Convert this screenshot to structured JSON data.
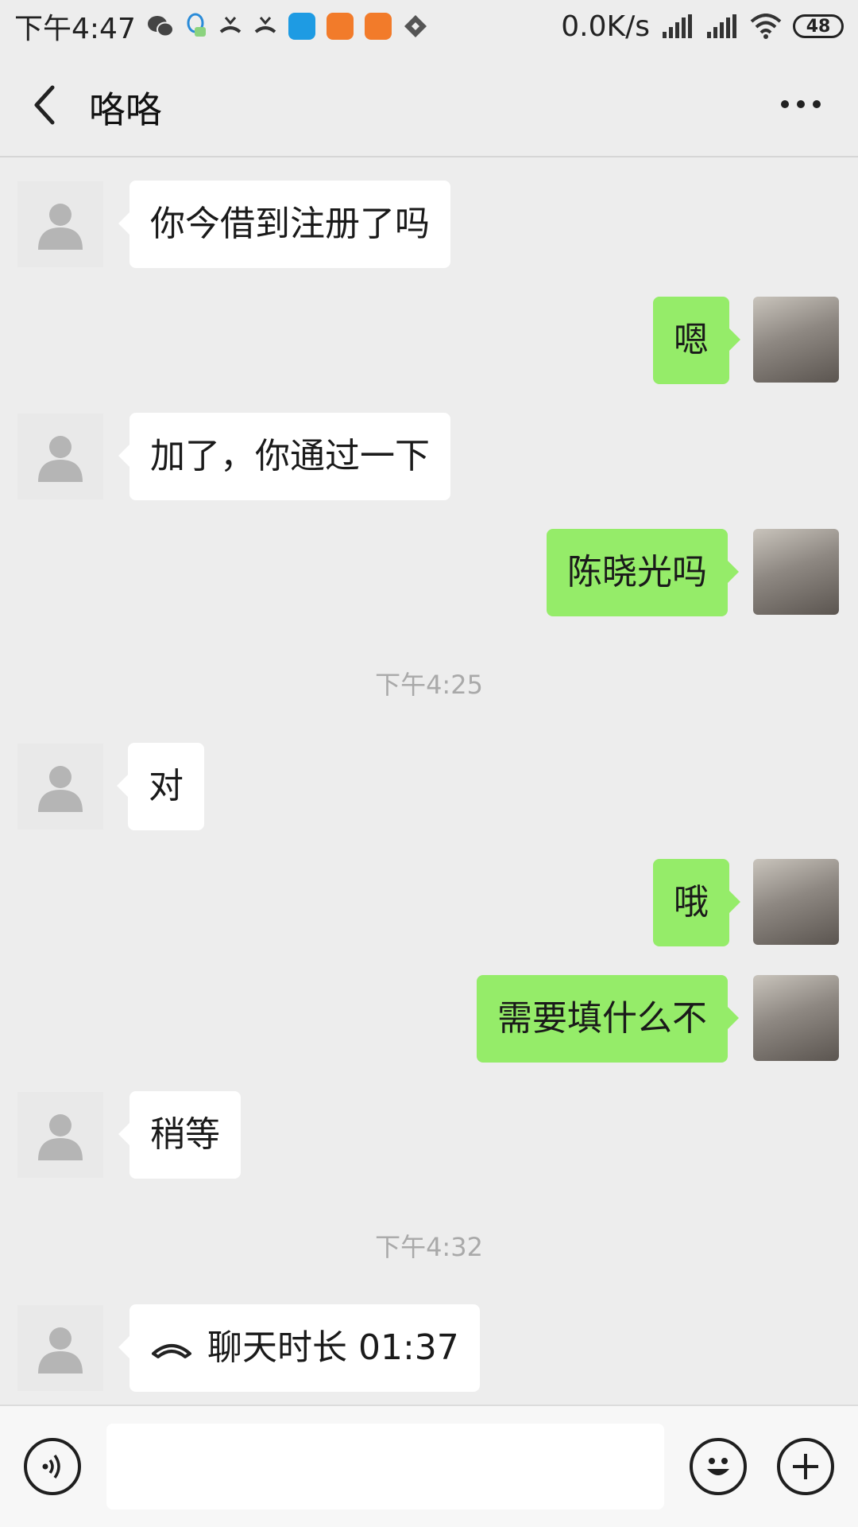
{
  "status_bar": {
    "time": "下午4:47",
    "net_speed": "0.0K/s",
    "battery": "48",
    "notification_icons": [
      "wechat-icon",
      "qq-icon",
      "missed-call-icon",
      "missed-call-icon",
      "app-icon",
      "uc-browser-icon",
      "uc-browser-icon",
      "diamond-app-icon"
    ]
  },
  "header": {
    "title": "咯咯"
  },
  "messages": [
    {
      "side": "in",
      "text": "你今借到注册了吗"
    },
    {
      "side": "out",
      "text": "嗯"
    },
    {
      "side": "in",
      "text": "加了，你通过一下"
    },
    {
      "side": "out",
      "text": "陈晓光吗"
    },
    {
      "side": "time",
      "text": "下午4:25"
    },
    {
      "side": "in",
      "text": "对"
    },
    {
      "side": "out",
      "text": "哦"
    },
    {
      "side": "out",
      "text": "需要填什么不"
    },
    {
      "side": "in",
      "text": "稍等"
    },
    {
      "side": "time",
      "text": "下午4:32"
    },
    {
      "side": "in",
      "text": "聊天时长 01:37",
      "type": "call"
    }
  ],
  "input": {
    "value": "",
    "placeholder": ""
  },
  "colors": {
    "outgoing_bubble": "#95ec69",
    "incoming_bubble": "#ffffff",
    "background": "#ededed"
  }
}
